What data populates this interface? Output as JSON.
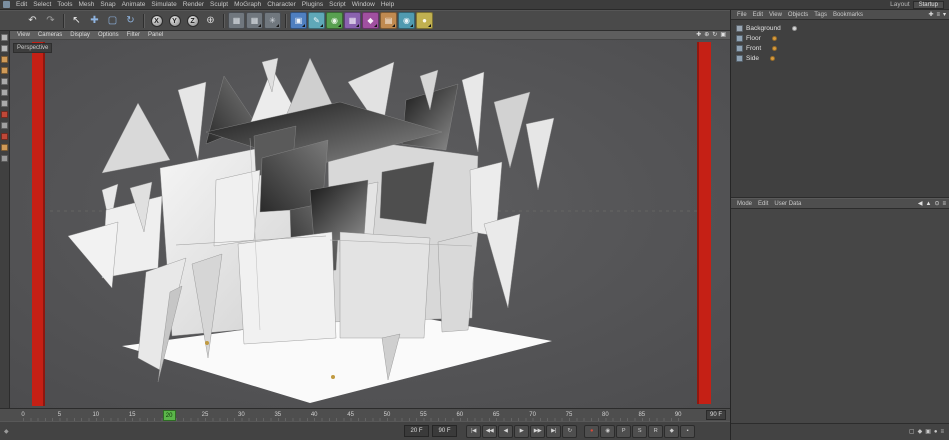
{
  "menubar": {
    "items": [
      "Edit",
      "Select",
      "Tools",
      "Mesh",
      "Snap",
      "Animate",
      "Simulate",
      "Render",
      "Sculpt",
      "MoGraph",
      "Character",
      "Plugins",
      "Script",
      "Window",
      "Help"
    ],
    "layout_label": "Layout",
    "layout_value": "Startup"
  },
  "toolbar": {
    "icons": [
      {
        "name": "undo-icon",
        "glyph": "↶",
        "fg": "#e0e0e0"
      },
      {
        "name": "redo-icon",
        "glyph": "↷",
        "fg": "#9d9d9d"
      },
      {
        "type": "sep"
      },
      {
        "name": "live-selection-icon",
        "glyph": "↖",
        "fg": "#f0f0f0"
      },
      {
        "name": "move-tool-icon",
        "glyph": "✚",
        "fg": "#8fb4e0"
      },
      {
        "name": "scale-tool-icon",
        "glyph": "▢",
        "fg": "#8fb4e0"
      },
      {
        "name": "rotate-tool-icon",
        "glyph": "↻",
        "fg": "#8fb4e0"
      },
      {
        "type": "sep"
      },
      {
        "name": "x-axis-lock-button",
        "type": "round",
        "letter": "X"
      },
      {
        "name": "y-axis-lock-button",
        "type": "round",
        "letter": "Y"
      },
      {
        "name": "z-axis-lock-button",
        "type": "round",
        "letter": "Z"
      },
      {
        "name": "coordinate-system-icon",
        "glyph": "⊕",
        "fg": "#d8d8d8"
      },
      {
        "type": "sep"
      },
      {
        "name": "render-view-icon",
        "glyph": "▦",
        "bg": "#70777e",
        "fg": "#d8dde2",
        "menu": false
      },
      {
        "name": "render-picture-viewer-icon",
        "glyph": "▦",
        "bg": "#70777e",
        "fg": "#d8dde2",
        "menu": true
      },
      {
        "name": "render-settings-icon",
        "glyph": "✳",
        "bg": "#70777e",
        "fg": "#d8dde2",
        "menu": true
      },
      {
        "type": "sep"
      },
      {
        "name": "add-cube-icon",
        "glyph": "▣",
        "bg": "#4f7fc0",
        "fg": "#eef3fa",
        "menu": true
      },
      {
        "name": "add-spline-icon",
        "glyph": "✎",
        "bg": "#5fa8b8",
        "fg": "#eef6f8",
        "menu": true
      },
      {
        "name": "add-subdivision-surface-icon",
        "glyph": "◉",
        "bg": "#58a050",
        "fg": "#ecf6ea",
        "menu": true
      },
      {
        "name": "add-array-icon",
        "glyph": "▦",
        "bg": "#8a62b0",
        "fg": "#f2ecf8",
        "menu": true
      },
      {
        "name": "add-deformer-icon",
        "glyph": "◆",
        "bg": "#a050a0",
        "fg": "#f8ecf8",
        "menu": true
      },
      {
        "name": "add-environment-icon",
        "glyph": "▤",
        "bg": "#c08a50",
        "fg": "#faf2ea",
        "menu": true
      },
      {
        "name": "add-camera-icon",
        "glyph": "◉",
        "bg": "#509ab0",
        "fg": "#eaf4f8",
        "menu": true
      },
      {
        "name": "add-light-icon",
        "glyph": "●",
        "bg": "#c0b050",
        "fg": "#faf8ea",
        "menu": true
      }
    ]
  },
  "left_toolbar": {
    "icons": [
      {
        "name": "make-editable-icon",
        "color": "#b8b8b8"
      },
      {
        "name": "model-mode-icon",
        "color": "#b8b8b8"
      },
      {
        "name": "texture-mode-icon",
        "color": "#cf9a58"
      },
      {
        "name": "workplane-mode-icon",
        "color": "#cf9a58"
      },
      {
        "name": "points-mode-icon",
        "color": "#aaaaaa"
      },
      {
        "name": "edges-mode-icon",
        "color": "#aaaaaa"
      },
      {
        "name": "polygons-mode-icon",
        "color": "#aaaaaa"
      },
      {
        "name": "enable-axis-icon",
        "color": "#c04838"
      },
      {
        "name": "viewport-solo-icon",
        "color": "#a0a0a0"
      },
      {
        "name": "enable-snap-icon",
        "color": "#c04838"
      },
      {
        "name": "workplane-snap-icon",
        "color": "#cf9a58"
      },
      {
        "name": "lock-workplane-icon",
        "color": "#9a9a9a"
      }
    ]
  },
  "viewport": {
    "label": "Perspective",
    "menu": [
      "View",
      "Cameras",
      "Display",
      "Options",
      "Filter",
      "Panel"
    ],
    "corner_icons": [
      {
        "name": "pan-view-icon",
        "glyph": "✚"
      },
      {
        "name": "zoom-view-icon",
        "glyph": "⊕"
      },
      {
        "name": "rotate-view-icon",
        "glyph": "↻"
      },
      {
        "name": "toggle-views-icon",
        "glyph": "▣"
      }
    ]
  },
  "object_manager": {
    "menu": [
      "File",
      "Edit",
      "View",
      "Objects",
      "Tags",
      "Bookmarks"
    ],
    "corner_icons": [
      {
        "name": "om-add-icon",
        "glyph": "✚"
      },
      {
        "name": "om-filter-icon",
        "glyph": "≡"
      },
      {
        "name": "om-dropdown-icon",
        "glyph": "▾"
      }
    ],
    "objects": [
      {
        "name": "Background",
        "icon": "background-object-icon",
        "icon_color": "#9aa7b4",
        "dot_color": "#d6d6d6"
      },
      {
        "name": "Floor",
        "icon": "floor-object-icon",
        "icon_color": "#8fa3b5",
        "dot_color": "#d89b3c"
      },
      {
        "name": "Front",
        "icon": "front-plane-object-icon",
        "icon_color": "#8fa3b5",
        "dot_color": "#d89b3c"
      },
      {
        "name": "Side",
        "icon": "side-plane-object-icon",
        "icon_color": "#8fa3b5",
        "dot_color": "#d89b3c"
      }
    ]
  },
  "attribute_manager": {
    "menu": [
      "Mode",
      "Edit",
      "User Data"
    ],
    "corner_icons": [
      {
        "name": "am-back-icon",
        "glyph": "◀"
      },
      {
        "name": "am-up-icon",
        "glyph": "▲"
      },
      {
        "name": "am-lock-icon",
        "glyph": "⊙"
      },
      {
        "name": "am-menu-icon",
        "glyph": "≡"
      }
    ]
  },
  "timeline": {
    "labels": [
      "0",
      "5",
      "10",
      "15",
      "20",
      "25",
      "30",
      "35",
      "40",
      "45",
      "50",
      "55",
      "60",
      "65",
      "70",
      "75",
      "80",
      "85",
      "90"
    ],
    "current_frame": 20,
    "marker_label": "20",
    "end_field": "90 F"
  },
  "transport": {
    "fields": [
      {
        "name": "current-frame-field",
        "value": "20 F"
      },
      {
        "name": "max-frame-field",
        "value": "90 F"
      }
    ],
    "buttons": [
      {
        "name": "goto-start-button",
        "glyph": "|◀"
      },
      {
        "name": "prev-key-button",
        "glyph": "◀◀"
      },
      {
        "name": "prev-frame-button",
        "glyph": "◀"
      },
      {
        "name": "play-button",
        "glyph": "▶"
      },
      {
        "name": "next-frame-button",
        "glyph": "▶▶"
      },
      {
        "name": "goto-end-button",
        "glyph": "▶|"
      },
      {
        "name": "loop-button",
        "glyph": "↻"
      }
    ],
    "record_buttons": [
      {
        "name": "record-button",
        "glyph": "●",
        "fg": "#d84a3a"
      },
      {
        "name": "autokey-button",
        "glyph": "◉",
        "fg": "#d0d0d0"
      },
      {
        "name": "record-position-button",
        "glyph": "P",
        "fg": "#d0d0d0"
      },
      {
        "name": "record-scale-button",
        "glyph": "S",
        "fg": "#d0d0d0"
      },
      {
        "name": "record-rotation-button",
        "glyph": "R",
        "fg": "#d0d0d0"
      },
      {
        "name": "record-parameter-button",
        "glyph": "◆",
        "fg": "#d0d0d0"
      },
      {
        "name": "record-pla-button",
        "glyph": "▪",
        "fg": "#d0d0d0"
      }
    ],
    "corner_glyph": "◆"
  },
  "status_icons": [
    {
      "name": "panel-button-1",
      "glyph": "▢"
    },
    {
      "name": "panel-button-2",
      "glyph": "◆"
    },
    {
      "name": "panel-button-3",
      "glyph": "▣"
    },
    {
      "name": "panel-button-4",
      "glyph": "●"
    },
    {
      "name": "panel-button-5",
      "glyph": "≡"
    }
  ],
  "colors": {
    "pillar_red": "#c52015",
    "floor_white": "#fafafa",
    "marker_green": "#5bb64a",
    "viewport_bg": "#545456"
  }
}
